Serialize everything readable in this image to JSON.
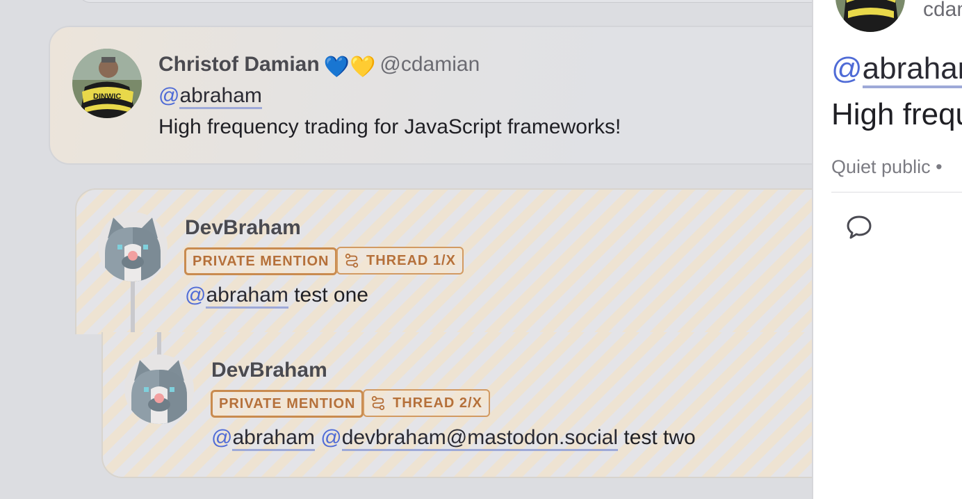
{
  "timeline": {
    "main_post": {
      "author_name": "Christof Damian",
      "author_emoji": "💙💛",
      "author_handle": "@cdamian",
      "mention_at": "@",
      "mention_name": "abraham",
      "text": "High frequency trading for JavaScript frameworks!"
    },
    "replies": [
      {
        "author_name": "DevBraham",
        "badge_private": "PRIVATE MENTION",
        "badge_thread": "THREAD 1/X",
        "mention_at": "@",
        "mention_name": "abraham",
        "text": "test one"
      },
      {
        "author_name": "DevBraham",
        "badge_private": "PRIVATE MENTION",
        "badge_thread": "THREAD 2/X",
        "mention1_at": "@",
        "mention1_name": "abraham",
        "mention2_at": "@",
        "mention2_name": "devbraham@mastodon.social",
        "text": "test two"
      }
    ]
  },
  "panel": {
    "author_handle": "cdamian",
    "mention_at": "@",
    "mention_name": "abraham",
    "text": "High frequency trading for JavaScript frameworks!",
    "meta": "Quiet public •",
    "reply_icon": "reply-bubble-icon"
  },
  "colors": {
    "mention_accent": "#4f6bd6",
    "badge_accent": "#b5703a",
    "background": "#dcdde1"
  }
}
